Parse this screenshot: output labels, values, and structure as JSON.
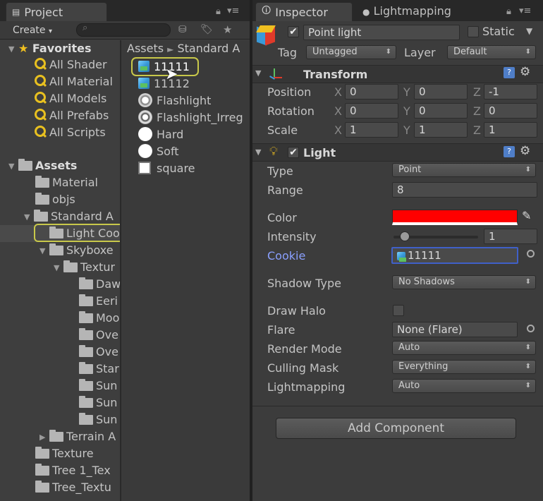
{
  "project": {
    "tab_label": "Project",
    "create_label": "Create",
    "breadcrumb_root": "Assets",
    "breadcrumb_next": "Standard A",
    "favorites_label": "Favorites",
    "favorites": [
      "All Shader",
      "All Material",
      "All Models",
      "All Prefabs",
      "All Scripts"
    ],
    "assets_label": "Assets",
    "tree": [
      "Material",
      "objs",
      "Standard A",
      "Light Coo",
      "Skyboxe",
      "Textur",
      "Daw",
      "Eeri",
      "Moo",
      "Ove",
      "Ove",
      "Star",
      "Sun",
      "Sun",
      "Sun",
      "Terrain A",
      "Texture",
      "Tree 1_Tex",
      "Tree_Textu"
    ],
    "files": [
      "11111",
      "11112",
      "Flashlight",
      "Flashlight_Irreg",
      "Hard",
      "Soft",
      "square"
    ]
  },
  "inspector": {
    "tab_label": "Inspector",
    "tab2_label": "Lightmapping",
    "object_name": "Point light",
    "static_label": "Static",
    "tag_label": "Tag",
    "tag_value": "Untagged",
    "layer_label": "Layer",
    "layer_value": "Default",
    "transform": {
      "title": "Transform",
      "position_label": "Position",
      "rotation_label": "Rotation",
      "scale_label": "Scale",
      "axis_x": "X",
      "axis_y": "Y",
      "axis_z": "Z",
      "position": [
        "0",
        "0",
        "-1"
      ],
      "rotation": [
        "0",
        "0",
        "0"
      ],
      "scale": [
        "1",
        "1",
        "1"
      ]
    },
    "light": {
      "title": "Light",
      "type_label": "Type",
      "type_value": "Point",
      "range_label": "Range",
      "range_value": "8",
      "color_label": "Color",
      "color_value": "#ff0000",
      "intensity_label": "Intensity",
      "intensity_value": "1",
      "cookie_label": "Cookie",
      "cookie_value": "11111",
      "shadow_label": "Shadow Type",
      "shadow_value": "No Shadows",
      "halo_label": "Draw Halo",
      "flare_label": "Flare",
      "flare_value": "None (Flare)",
      "render_label": "Render Mode",
      "render_value": "Auto",
      "culling_label": "Culling Mask",
      "culling_value": "Everything",
      "lightmapping_label": "Lightmapping",
      "lightmapping_value": "Auto"
    },
    "add_component_label": "Add Component"
  }
}
